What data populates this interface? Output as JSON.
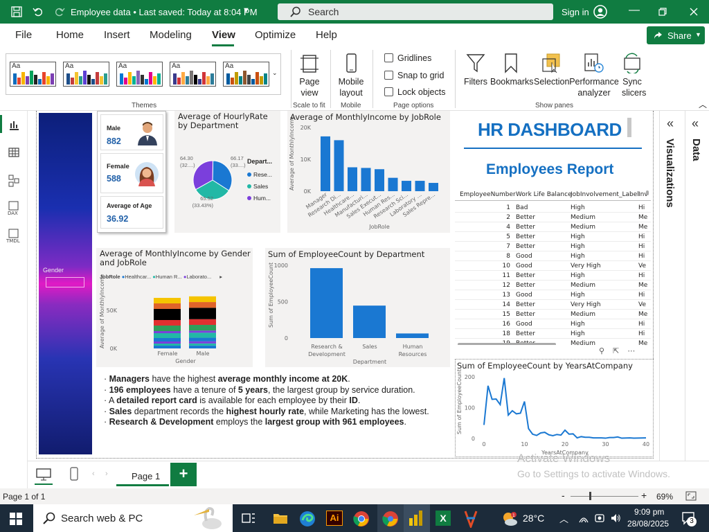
{
  "titlebar": {
    "doc_title": "Employee data • Last saved: Today at 8:04 PM",
    "search_placeholder": "Search",
    "sign_in": "Sign in"
  },
  "tabs": [
    "File",
    "Home",
    "Insert",
    "Modeling",
    "View",
    "Optimize",
    "Help"
  ],
  "active_tab": "View",
  "share_label": "Share",
  "ribbon": {
    "themes_label": "Themes",
    "theme_swatch_text": "Aa",
    "page_view": "Page view",
    "scale_group": "Scale to fit",
    "mobile_layout": "Mobile layout",
    "mobile_group": "Mobile",
    "gridlines": "Gridlines",
    "snap": "Snap to grid",
    "lock": "Lock objects",
    "page_options": "Page options",
    "filters": "Filters",
    "bookmarks": "Bookmarks",
    "selection": "Selection",
    "performance": "Performance analyzer",
    "sync": "Sync slicers",
    "show_panes": "Show panes"
  },
  "slicer": {
    "label": "Gender"
  },
  "cards": {
    "male_label": "Male",
    "male_value": "882",
    "female_label": "Female",
    "female_value": "588",
    "age_label": "Average of Age",
    "age_value": "36.92"
  },
  "pie": {
    "title": "Average of HourlyRate by Department",
    "legend_title": "Depart...",
    "legend": [
      "Rese...",
      "Sales",
      "Hum..."
    ],
    "labels": [
      "64.30 (32....)",
      "66.17 (33....)",
      "65.52 (33.43%)"
    ]
  },
  "jobrole_chart": {
    "title": "Average of MonthlyIncome by JobRole",
    "ylabel": "Average of MonthlyIncome",
    "xlabel": "JobRole",
    "yticks": [
      "20K",
      "10K",
      "0K"
    ],
    "categories": [
      "Manager",
      "Research Di...",
      "Healthcare...",
      "Manufacturi...",
      "Sales Execut...",
      "Human Res...",
      "Research Sci...",
      "Laboratory ...",
      "Sales Repre..."
    ]
  },
  "header": {
    "title": "HR DASHBOARD",
    "subtitle": "Employees Report"
  },
  "table": {
    "columns": [
      "EmployeeNumber",
      "Work Life Balance",
      "JobInvolvement_Label",
      "Inv"
    ],
    "rows": [
      [
        "1",
        "Bad",
        "High",
        "Hi"
      ],
      [
        "2",
        "Better",
        "Medium",
        "Me"
      ],
      [
        "4",
        "Better",
        "Medium",
        "Me"
      ],
      [
        "5",
        "Better",
        "High",
        "Hi"
      ],
      [
        "7",
        "Better",
        "High",
        "Hi"
      ],
      [
        "8",
        "Good",
        "High",
        "Hi"
      ],
      [
        "10",
        "Good",
        "Very High",
        "Ve"
      ],
      [
        "11",
        "Better",
        "High",
        "Hi"
      ],
      [
        "12",
        "Better",
        "Medium",
        "Me"
      ],
      [
        "13",
        "Good",
        "High",
        "Hi"
      ],
      [
        "14",
        "Better",
        "Very High",
        "Ve"
      ],
      [
        "15",
        "Better",
        "Medium",
        "Me"
      ],
      [
        "16",
        "Good",
        "High",
        "Hi"
      ],
      [
        "18",
        "Better",
        "High",
        "Hi"
      ],
      [
        "19",
        "Better",
        "Medium",
        "Me"
      ]
    ]
  },
  "gender_chart": {
    "title": "Average of MonthlyIncome by Gender and JobRole",
    "legend_title": "JobRole",
    "legend": [
      "Healthcar...",
      "Human R...",
      "Laborato..."
    ],
    "ylabel": "Average of MonthlyIncome",
    "xlabel": "Gender",
    "yticks": [
      "50K",
      "0K"
    ],
    "categories": [
      "Female",
      "Male"
    ]
  },
  "dept_chart": {
    "title": "Sum of EmployeeCount by Department",
    "ylabel": "Sum of EmployeeCount",
    "xlabel": "Department",
    "yticks": [
      "1000",
      "500",
      "0"
    ],
    "categories": [
      "Research & Development",
      "Sales",
      "Human Resources"
    ]
  },
  "years_chart": {
    "title": "Sum of EmployeeCount by YearsAtCompany",
    "ylabel": "Sum of EmployeeCount",
    "xlabel": "YearsAtCompany",
    "yticks": [
      "200",
      "100",
      "0"
    ],
    "xticks": [
      "0",
      "10",
      "20",
      "30",
      "40"
    ]
  },
  "insights": [
    {
      "pre": "",
      "b1": "Managers",
      "mid": " have the highest ",
      "b2": "average monthly income at 20K",
      "post": "."
    },
    {
      "pre": "",
      "b1": "196 employees",
      "mid": " have a tenure of ",
      "b2": "5 years",
      "post": ", the largest group by service duration."
    },
    {
      "pre": "A ",
      "b1": "detailed report card",
      "mid": " is available for each employee by their ",
      "b2": "ID",
      "post": "."
    },
    {
      "pre": "",
      "b1": "Sales",
      "mid": " department records the ",
      "b2": "highest hourly rate",
      "post": ", while Marketing has the lowest."
    },
    {
      "pre": "",
      "b1": "Research & Development",
      "mid": " employs the ",
      "b2": "largest group with 961 employees",
      "post": "."
    }
  ],
  "panes": {
    "visualizations": "Visualizations",
    "data": "Data"
  },
  "page_tab": "Page 1",
  "status": {
    "page": "Page 1 of 1",
    "zoom": "69%"
  },
  "watermark": {
    "line1": "Activate Windows",
    "line2": "Go to Settings to activate Windows."
  },
  "taskbar": {
    "search": "Search web & PC",
    "temp": "28°C",
    "time": "9:09 pm",
    "date": "28/08/2025",
    "badge": "3"
  },
  "chart_data": [
    {
      "type": "pie",
      "title": "Average of HourlyRate by Department",
      "categories": [
        "Research & Development",
        "Sales",
        "Human Resources"
      ],
      "values": [
        66.17,
        64.3,
        65.52
      ]
    },
    {
      "type": "bar",
      "title": "Average of MonthlyIncome by JobRole",
      "categories": [
        "Manager",
        "Research Director",
        "Healthcare Representative",
        "Manufacturing Director",
        "Sales Executive",
        "Human Resources",
        "Research Scientist",
        "Laboratory Technician",
        "Sales Representative"
      ],
      "values": [
        17200,
        16000,
        7500,
        7300,
        6900,
        4200,
        3250,
        3250,
        2600
      ],
      "ylim": [
        0,
        20000
      ]
    },
    {
      "type": "bar",
      "title": "Sum of EmployeeCount by Department",
      "categories": [
        "Research & Development",
        "Sales",
        "Human Resources"
      ],
      "values": [
        961,
        446,
        63
      ],
      "ylim": [
        0,
        1000
      ]
    },
    {
      "type": "line",
      "title": "Sum of EmployeeCount by YearsAtCompany",
      "x": [
        0,
        1,
        2,
        3,
        4,
        5,
        6,
        7,
        8,
        9,
        10,
        11,
        12,
        13,
        14,
        15,
        16,
        17,
        18,
        19,
        20,
        21,
        22,
        23,
        24,
        25,
        26,
        27,
        28,
        29,
        30,
        31,
        32,
        33,
        34,
        36,
        37,
        40
      ],
      "values": [
        44,
        171,
        127,
        128,
        110,
        196,
        76,
        90,
        80,
        82,
        120,
        32,
        14,
        10,
        18,
        20,
        12,
        9,
        13,
        11,
        27,
        14,
        15,
        2,
        6,
        4,
        4,
        2,
        2,
        2,
        1,
        3,
        3,
        5,
        1,
        2,
        1,
        2
      ],
      "ylim": [
        0,
        220
      ]
    }
  ]
}
